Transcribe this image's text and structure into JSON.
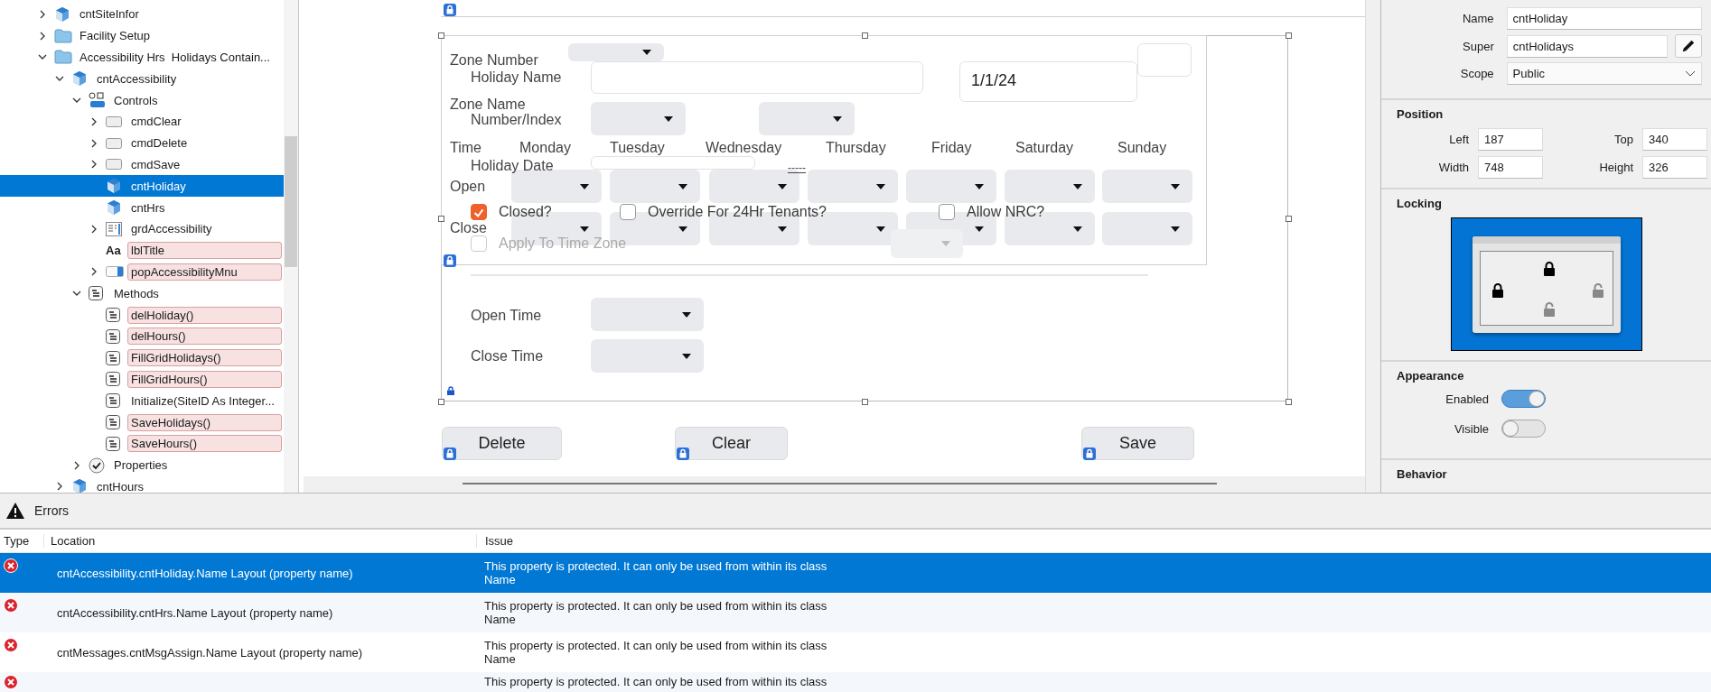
{
  "tree": {
    "items": [
      {
        "label": "cntSiteInfor",
        "kind": "container",
        "expanded": false,
        "selected": false,
        "error": false
      },
      {
        "label": "Facility Setup",
        "kind": "folder",
        "expanded": false,
        "selected": false,
        "error": false
      },
      {
        "label": "Accessibility Hrs  Holidays Contain...",
        "kind": "folder",
        "expanded": true,
        "selected": false,
        "error": false,
        "children": [
          {
            "label": "cntAccessibility",
            "kind": "container",
            "expanded": true,
            "selected": false,
            "error": false,
            "children": [
              {
                "label": "Controls",
                "kind": "controls",
                "expanded": true,
                "selected": false,
                "error": false,
                "children": [
                  {
                    "label": "cmdClear",
                    "kind": "button",
                    "expanded": false,
                    "selected": false,
                    "error": false
                  },
                  {
                    "label": "cmdDelete",
                    "kind": "button",
                    "expanded": false,
                    "selected": false,
                    "error": false
                  },
                  {
                    "label": "cmdSave",
                    "kind": "button",
                    "expanded": false,
                    "selected": false,
                    "error": false
                  },
                  {
                    "label": "cntHoliday",
                    "kind": "container",
                    "selected": true,
                    "error": false
                  },
                  {
                    "label": "cntHrs",
                    "kind": "container",
                    "selected": false,
                    "error": false
                  },
                  {
                    "label": "grdAccessibility",
                    "kind": "grid",
                    "expanded": false,
                    "selected": false,
                    "error": false
                  },
                  {
                    "label": "lblTitle",
                    "kind": "label",
                    "icon_text": "Aa",
                    "selected": false,
                    "error": true
                  },
                  {
                    "label": "popAccessibilityMnu",
                    "kind": "popup",
                    "expanded": false,
                    "selected": false,
                    "error": true
                  }
                ]
              },
              {
                "label": "Methods",
                "kind": "method",
                "expanded": true,
                "selected": false,
                "error": false,
                "children": [
                  {
                    "label": "delHoliday()",
                    "kind": "method",
                    "selected": false,
                    "error": true
                  },
                  {
                    "label": "delHours()",
                    "kind": "method",
                    "selected": false,
                    "error": true
                  },
                  {
                    "label": "FillGridHolidays()",
                    "kind": "method",
                    "selected": false,
                    "error": true
                  },
                  {
                    "label": "FillGridHours()",
                    "kind": "method",
                    "selected": false,
                    "error": true
                  },
                  {
                    "label": "Initialize(SiteID As Integer...",
                    "kind": "method",
                    "selected": false,
                    "error": false
                  },
                  {
                    "label": "SaveHolidays()",
                    "kind": "method",
                    "selected": false,
                    "error": true
                  },
                  {
                    "label": "SaveHours()",
                    "kind": "method",
                    "selected": false,
                    "error": true
                  }
                ]
              },
              {
                "label": "Properties",
                "kind": "properties",
                "expanded": false,
                "selected": false,
                "error": false
              }
            ]
          },
          {
            "label": "cntHours",
            "kind": "container",
            "expanded": false,
            "selected": false,
            "error": false
          }
        ]
      }
    ]
  },
  "designer": {
    "zone_number_label": "Zone Number",
    "holiday_name_label": "Holiday Name",
    "zone_name_label": "Zone Name",
    "number_index_label": "Number/Index",
    "day_headers": [
      "Time",
      "Monday",
      "Tuesday",
      "Wednesday",
      "Thursday",
      "Friday",
      "Saturday",
      "Sunday"
    ],
    "holiday_date_label": "Holiday Date",
    "date_value": "1/1/24",
    "dash_text": "-----",
    "open_label": "Open",
    "close_label": "Close",
    "checkboxes": [
      {
        "label": "Closed?",
        "checked": true,
        "disabled": false
      },
      {
        "label": "Override For 24Hr Tenants?",
        "checked": false,
        "disabled": false
      },
      {
        "label": "Allow NRC?",
        "checked": false,
        "disabled": false
      },
      {
        "label": "Apply To Time Zone",
        "checked": false,
        "disabled": true
      }
    ],
    "dropdowns": [
      {
        "disabled": false
      },
      {
        "disabled": false
      },
      {
        "disabled": false
      },
      {
        "disabled": false
      },
      {
        "disabled": false
      },
      {
        "disabled": false
      },
      {
        "disabled": false
      },
      {
        "disabled": false
      },
      {
        "disabled": false
      },
      {
        "disabled": false
      },
      {
        "disabled": false
      },
      {
        "disabled": false
      },
      {
        "disabled": false
      },
      {
        "disabled": false
      },
      {
        "disabled": false
      },
      {
        "disabled": false
      },
      {
        "disabled": false
      },
      {
        "disabled": true
      },
      {
        "disabled": false
      },
      {
        "disabled": false
      }
    ],
    "open_time_label": "Open Time",
    "close_time_label": "Close Time",
    "buttons": [
      "Delete",
      "Clear",
      "Save"
    ]
  },
  "inspector": {
    "name_label": "Name",
    "name_value": "cntHoliday",
    "super_label": "Super",
    "super_value": "cntHolidays",
    "scope_label": "Scope",
    "scope_value": "Public",
    "position_title": "Position",
    "position_fields": [
      {
        "label": "Left",
        "value": "187"
      },
      {
        "label": "Top",
        "value": "340"
      },
      {
        "label": "Width",
        "value": "748"
      },
      {
        "label": "Height",
        "value": "326"
      }
    ],
    "locking_title": "Locking",
    "locks": [
      {
        "locked": true
      },
      {
        "locked": true
      },
      {
        "locked": false
      },
      {
        "locked": false
      }
    ],
    "appearance_title": "Appearance",
    "toggles": [
      {
        "label": "Enabled",
        "on": true
      },
      {
        "label": "Visible",
        "on": false
      }
    ],
    "behavior_title": "Behavior"
  },
  "errors": {
    "title": "Errors",
    "columns": [
      "Type",
      "Location",
      "Issue"
    ],
    "rows": [
      {
        "location": "cntAccessibility.cntHoliday.Name Layout (property name)",
        "issue": "This property is protected. It can only be used from within its class",
        "issue_detail": "Name",
        "selected": true
      },
      {
        "location": "cntAccessibility.cntHrs.Name Layout (property name)",
        "issue": "This property is protected. It can only be used from within its class",
        "issue_detail": "Name",
        "selected": false
      },
      {
        "location": "cntMessages.cntMsgAssign.Name Layout (property name)",
        "issue": "This property is protected. It can only be used from within its class",
        "issue_detail": "Name",
        "selected": false
      },
      {
        "issue": "This property is protected. It can only be used from within its class",
        "selected": false
      }
    ]
  }
}
